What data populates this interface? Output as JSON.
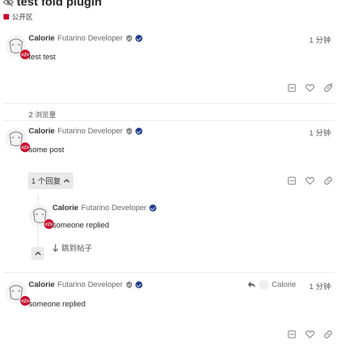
{
  "topic": {
    "title": "test fold plugin",
    "category": "公开区",
    "views_count": "2",
    "views_label": "浏览量"
  },
  "icons": {
    "unlisted": "eye-slash-icon",
    "category_badge": "square-icon",
    "flair": "checkmark-circle-icon",
    "verified": "shield-icon",
    "share": "share-icon",
    "like": "heart-icon",
    "link": "link-icon",
    "reply_to": "reply-arrow-icon",
    "jump": "arrow-down-icon",
    "chevron_up": "chevron-up-icon",
    "avatar_badge": "code-badge-icon"
  },
  "posts": [
    {
      "username": "Calorie",
      "user_title": "Futarino Developer",
      "time": "1 分钟",
      "body": "test test"
    },
    {
      "username": "Calorie",
      "user_title": "Futarino Developer",
      "time": "1 分钟",
      "body": "some post",
      "replies_button": "1 个回复",
      "nested_reply": {
        "username": "Calorie",
        "user_title": "Futarino Developer",
        "body": "someone replied",
        "jump_label": "跳到帖子"
      }
    },
    {
      "username": "Calorie",
      "user_title": "Futarino Developer",
      "time": "1 分钟",
      "body": "someone replied",
      "reply_to_user": "Calorie"
    }
  ],
  "colors": {
    "brand_red": "#c8102e",
    "flair_blue": "#1e3a8a",
    "muted_text": "#666666",
    "button_bg": "#e9e9e9"
  }
}
